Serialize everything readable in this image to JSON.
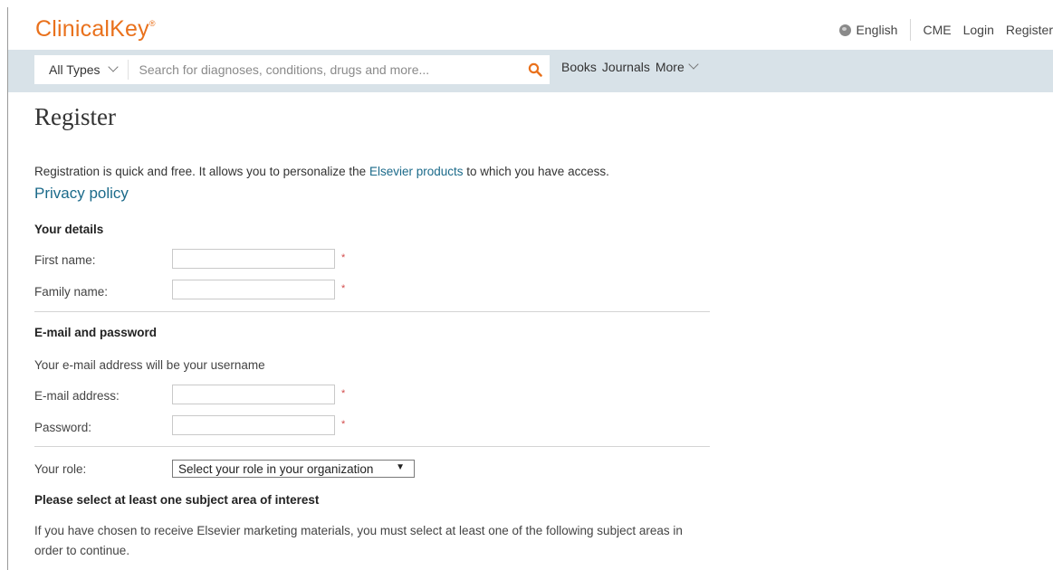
{
  "header": {
    "logo_text": "ClinicalKey",
    "logo_mark": "®",
    "logo_color": "#e9711c",
    "language": "English",
    "links": [
      "CME",
      "Login",
      "Register"
    ]
  },
  "search": {
    "type_label": "All Types",
    "placeholder": "Search for diagnoses, conditions, drugs and more...",
    "search_icon": "search-icon",
    "nav": [
      "Books",
      "Journals",
      "More"
    ]
  },
  "page": {
    "title": "Register",
    "intro_before": "Registration is quick and free. It allows you to personalize the ",
    "intro_link": "Elsevier products",
    "intro_after": " to which you have access.",
    "privacy": "Privacy policy"
  },
  "details": {
    "heading": "Your details",
    "first_name_label": "First name:",
    "family_name_label": "Family name:",
    "required_mark": "*"
  },
  "credentials": {
    "heading": "E-mail and password",
    "note": "Your e-mail address will be your username",
    "email_label": "E-mail address:",
    "password_label": "Password:",
    "required_mark": "*"
  },
  "role": {
    "label": "Your role:",
    "selected": "Select your role in your organization",
    "arrow": "▼"
  },
  "subjects": {
    "heading": "Please select at least one subject area of interest",
    "text": "If you have chosen to receive Elsevier marketing materials, you must select at least one of the following subject areas in order to continue."
  }
}
